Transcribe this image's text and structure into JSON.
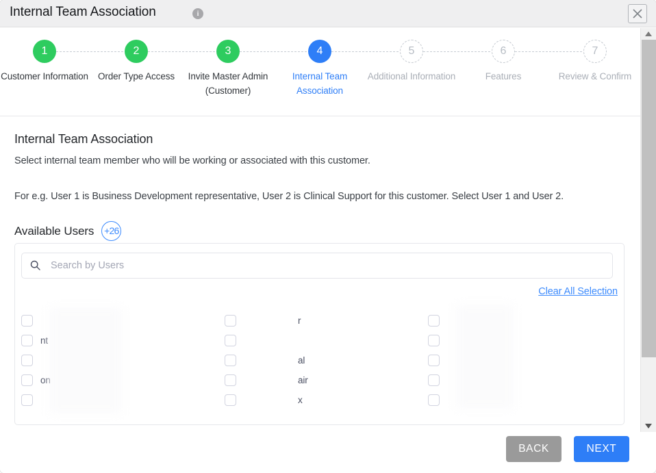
{
  "window": {
    "title": "Internal Team Association",
    "info_icon": "info-icon",
    "close_icon": "close-icon"
  },
  "stepper": {
    "steps": [
      {
        "number": "1",
        "label": "Customer Information",
        "state": "done"
      },
      {
        "number": "2",
        "label": "Order Type Access",
        "state": "done"
      },
      {
        "number": "3",
        "label": "Invite Master Admin (Customer)",
        "state": "done"
      },
      {
        "number": "4",
        "label": "Internal Team Association",
        "state": "active"
      },
      {
        "number": "5",
        "label": "Additional Information",
        "state": "todo"
      },
      {
        "number": "6",
        "label": "Features",
        "state": "todo"
      },
      {
        "number": "7",
        "label": "Review & Confirm",
        "state": "todo"
      }
    ]
  },
  "main": {
    "section_title": "Internal Team Association",
    "description": "Select internal team member who will be working or associated with this customer.",
    "example": "For e.g. User 1 is Business Development representative, User 2 is Clinical Support for this customer. Select User 1 and User 2.",
    "available_users_label": "Available Users",
    "available_users_count": "+26"
  },
  "search": {
    "placeholder": "Search by Users",
    "value": "",
    "icon": "search-icon"
  },
  "clear_all": {
    "label": "Clear All Selection"
  },
  "user_columns": [
    {
      "users": [
        {
          "name": "",
          "checked": false
        },
        {
          "name": "nt",
          "checked": false
        },
        {
          "name": "",
          "checked": false
        },
        {
          "name": "on",
          "checked": false
        },
        {
          "name": "",
          "checked": false
        }
      ]
    },
    {
      "users": [
        {
          "name": "r",
          "checked": false
        },
        {
          "name": "",
          "checked": false
        },
        {
          "name": "al",
          "checked": false
        },
        {
          "name": "air",
          "checked": false
        },
        {
          "name": "x",
          "checked": false
        }
      ]
    },
    {
      "users": [
        {
          "name": "",
          "checked": false
        },
        {
          "name": "",
          "checked": false
        },
        {
          "name": "",
          "checked": false
        },
        {
          "name": "",
          "checked": false
        },
        {
          "name": "",
          "checked": false
        }
      ]
    }
  ],
  "footer": {
    "back_label": "BACK",
    "next_label": "NEXT"
  },
  "colors": {
    "accent_blue": "#2e7ef7",
    "done_green": "#2ecc5f",
    "link_blue": "#3d8bfd",
    "back_gray": "#9a9a9a"
  },
  "scrollbar": {
    "up_icon": "chevron-up-icon",
    "down_icon": "chevron-down-icon"
  }
}
